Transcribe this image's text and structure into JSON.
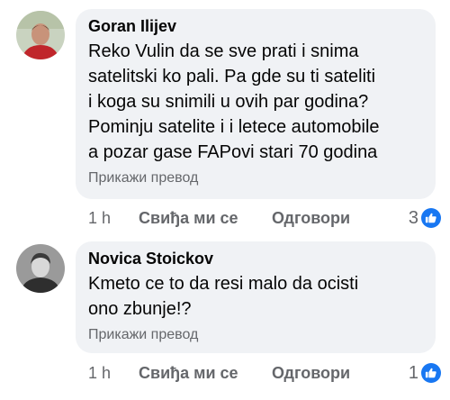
{
  "comments": [
    {
      "author": "Goran Ilijev",
      "text": "Reko Vulin da  se sve prati i snima\nsatelitski ko pali. Pa gde su ti sateliti\ni koga su snimili u ovih par godina?\nPominju satelite i i letece automobile\na pozar gase FAPovi stari 70 godina",
      "translate": "Прикажи превод",
      "time": "1 h",
      "like": "Свиђа ми се",
      "reply": "Одговори",
      "reactions": "3",
      "reaction_icon": "like-thumb-icon",
      "avatar_colors": {
        "bg": "#c9d3c0",
        "shirt": "#c0262b",
        "skin": "#c8937a"
      }
    },
    {
      "author": "Novica Stoickov",
      "text": "Kmeto ce to da resi malo da ocisti\nono zbunje!?",
      "translate": "Прикажи превод",
      "time": "1 h",
      "like": "Свиђа ми се",
      "reply": "Одговори",
      "reactions": "1",
      "reaction_icon": "like-thumb-icon",
      "avatar_colors": {
        "bg": "#9a9a9a",
        "shirt": "#2e2e2e",
        "skin": "#d8d8d8"
      }
    }
  ],
  "colors": {
    "bubble": "#f0f2f5",
    "secondary_text": "#65676b",
    "like_blue": "#1877f2"
  }
}
